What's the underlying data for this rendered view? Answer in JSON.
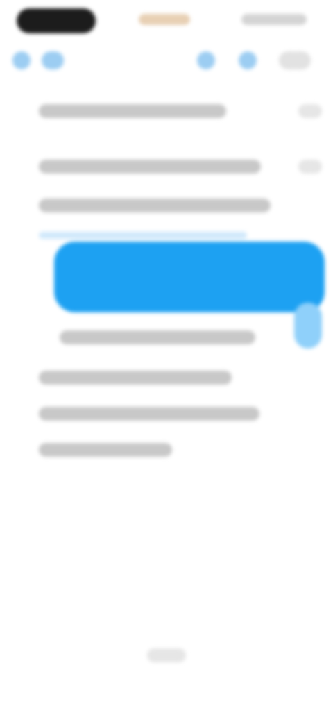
{
  "status_bar": {
    "time_icon": "time-pill",
    "center_icon": "notification-indicator",
    "right_icons": "signal-wifi-battery-icons"
  },
  "toolbar": {
    "back_icon": "back-icon",
    "icons": [
      "action-icon",
      "action-icon",
      "more-icon"
    ]
  },
  "content": {
    "selection_color": "#1da1f2",
    "selection_tail_color": "#8fd0fa",
    "text_color": "#c8c8c8"
  }
}
